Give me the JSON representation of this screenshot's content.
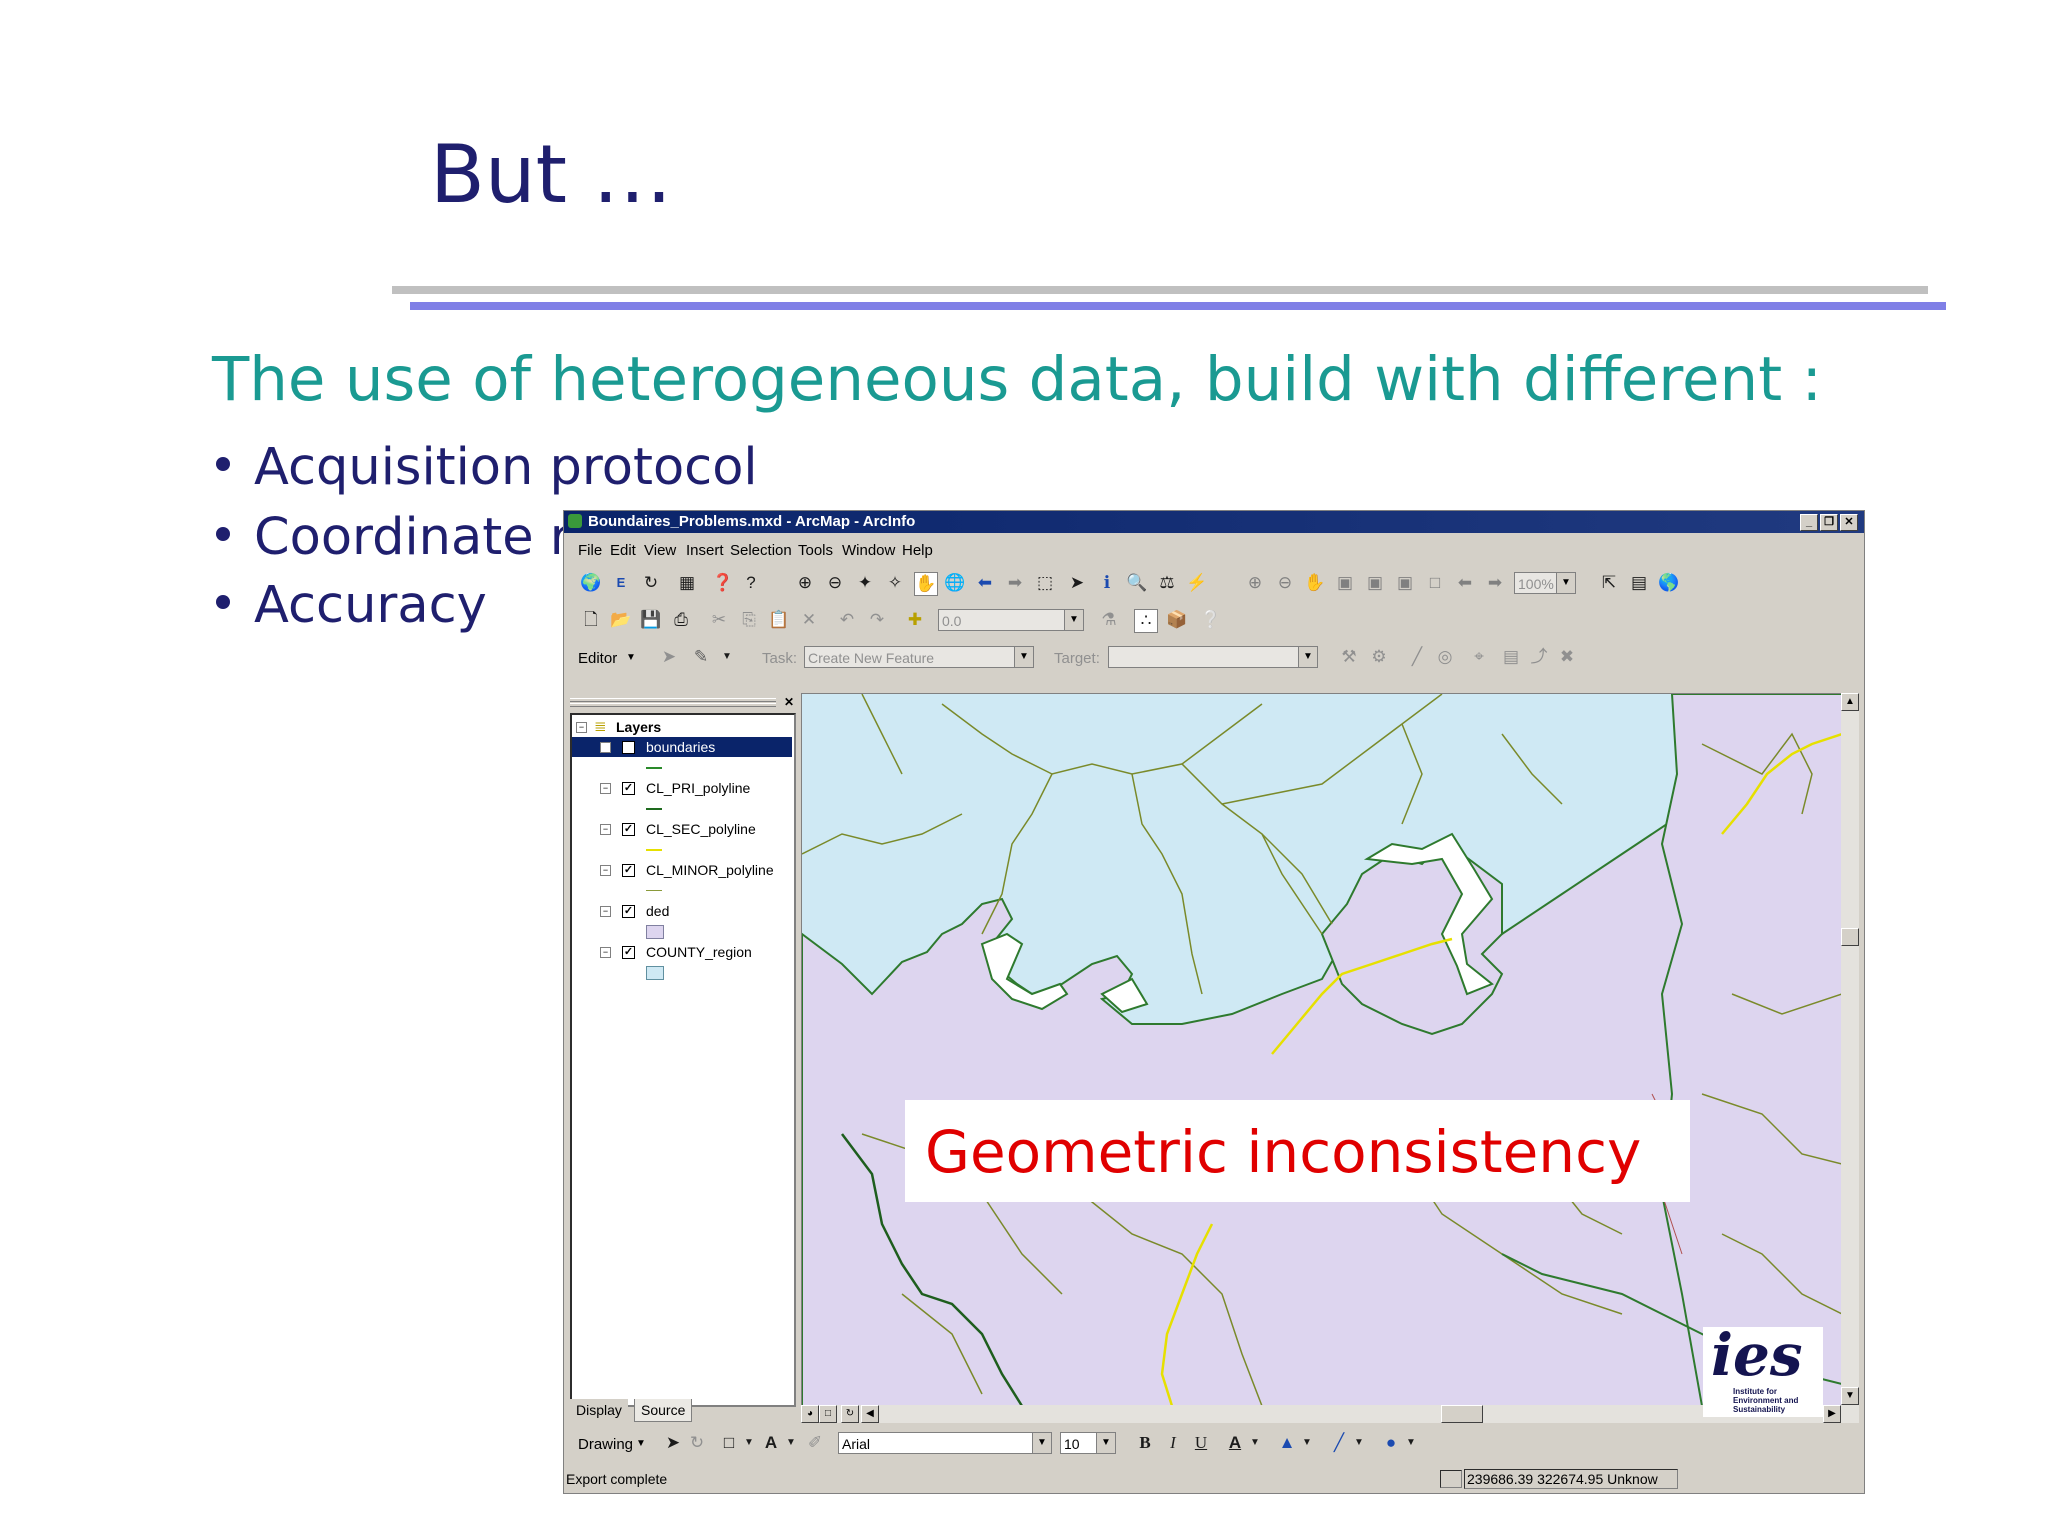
{
  "slide": {
    "title": "But …",
    "subtitle": "The use of heterogeneous data, build with different :",
    "bullets": [
      "Acquisition protocol",
      "Coordinate re",
      "Accuracy"
    ]
  },
  "window": {
    "title": "Boundaires_Problems.mxd - ArcMap - ArcInfo",
    "menu": [
      "File",
      "Edit",
      "View",
      "Insert",
      "Selection",
      "Tools",
      "Window",
      "Help"
    ],
    "zoom_combo": "100%",
    "scale_combo": "0.0",
    "editor_label": "Editor",
    "task_label": "Task:",
    "task_value": "Create New Feature",
    "target_label": "Target:",
    "toc": {
      "root": "Layers",
      "layers": [
        "boundaries",
        "CL_PRI_polyline",
        "CL_SEC_polyline",
        "CL_MINOR_polyline",
        "ded",
        "COUNTY_region"
      ]
    },
    "tabs": [
      "Display",
      "Source"
    ],
    "drawing": {
      "label": "Drawing",
      "font_name": "Arial",
      "font_size": "10",
      "bold": "B",
      "italic": "I",
      "underline": "U",
      "font_color_glyph": "A"
    },
    "status": {
      "message": "Export complete",
      "coords": "239686.39  322674.95 Unknow"
    }
  },
  "overlay": {
    "label": "Geometric inconsistency"
  },
  "logo": {
    "mark": "ies",
    "text": [
      "Institute for",
      "Environment and",
      "Sustainability"
    ]
  },
  "colors": {
    "title": "#1f1f6e",
    "subtitle": "#1a9a92",
    "overlay_text": "#e00000",
    "map_water": "#cfe9f4",
    "map_land": "#ddd5ef",
    "selection": "#0a246a"
  }
}
